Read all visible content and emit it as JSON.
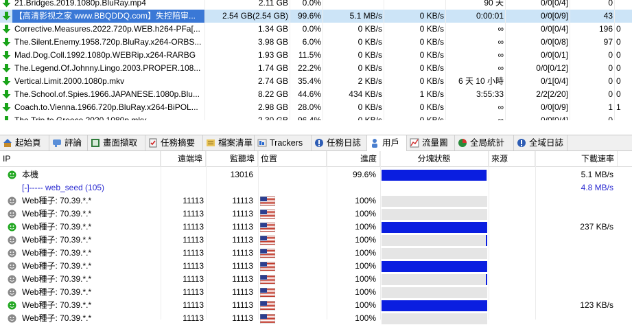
{
  "torrents": [
    {
      "name": "21.Bridges.2019.1080p.BluRay.mp4",
      "size": "2.11 GB",
      "pct": "0.0%",
      "dl": "",
      "ul": "",
      "eta": "90 天",
      "peers": "0/0[0/4]",
      "seeds": "0",
      "extra": ""
    },
    {
      "name": "【高清影视之家 www.BBQDDQ.com】失控陪审...",
      "size": "2.54 GB(2.54 GB)",
      "pct": "99.6%",
      "dl": "5.1 MB/s",
      "ul": "0 KB/s",
      "eta": "0:00:01",
      "peers": "0/0[0/9]",
      "seeds": "43",
      "extra": "",
      "selected": true
    },
    {
      "name": "Corrective.Measures.2022.720p.WEB.h264-PFa[...",
      "size": "1.34 GB",
      "pct": "0.0%",
      "dl": "0 KB/s",
      "ul": "0 KB/s",
      "eta": "∞",
      "peers": "0/0[0/4]",
      "seeds": "196",
      "extra": "0"
    },
    {
      "name": "The.Silent.Enemy.1958.720p.BluRay.x264-ORBS...",
      "size": "3.98 GB",
      "pct": "6.0%",
      "dl": "0 KB/s",
      "ul": "0 KB/s",
      "eta": "∞",
      "peers": "0/0[0/8]",
      "seeds": "97",
      "extra": "0"
    },
    {
      "name": "Mad.Dog.Coll.1992.1080p.WEBRip.x264-RARBG",
      "size": "1.93 GB",
      "pct": "11.5%",
      "dl": "0 KB/s",
      "ul": "0 KB/s",
      "eta": "∞",
      "peers": "0/0[0/1]",
      "seeds": "0",
      "extra": "0"
    },
    {
      "name": "The.Legend.Of.Johnny.Lingo.2003.PROPER.108...",
      "size": "1.74 GB",
      "pct": "22.2%",
      "dl": "0 KB/s",
      "ul": "0 KB/s",
      "eta": "∞",
      "peers": "0/0[0/12]",
      "seeds": "0",
      "extra": "0"
    },
    {
      "name": "Vertical.Limit.2000.1080p.mkv",
      "size": "2.74 GB",
      "pct": "35.4%",
      "dl": "2 KB/s",
      "ul": "0 KB/s",
      "eta": "6 天 10 小時",
      "peers": "0/1[0/4]",
      "seeds": "0",
      "extra": "0"
    },
    {
      "name": "The.School.of.Spies.1966.JAPANESE.1080p.Blu...",
      "size": "8.22 GB",
      "pct": "44.6%",
      "dl": "434 KB/s",
      "ul": "1 KB/s",
      "eta": "3:55:33",
      "peers": "2/2[2/20]",
      "seeds": "0",
      "extra": "0"
    },
    {
      "name": "Coach.to.Vienna.1966.720p.BluRay.x264-BiPOL...",
      "size": "2.98 GB",
      "pct": "28.0%",
      "dl": "0 KB/s",
      "ul": "0 KB/s",
      "eta": "∞",
      "peers": "0/0[0/9]",
      "seeds": "1",
      "extra": "1"
    },
    {
      "name": "The.Trip.to.Greece.2020.1080p.mkv",
      "size": "2.30 GB",
      "pct": "96.4%",
      "dl": "0 KB/s",
      "ul": "0 KB/s",
      "eta": "∞",
      "peers": "0/0[0/4]",
      "seeds": "0",
      "extra": ""
    }
  ],
  "tabs": [
    {
      "label": "起始頁",
      "icon": "home-icon"
    },
    {
      "label": "評論",
      "icon": "comment-icon"
    },
    {
      "label": "畫面擷取",
      "icon": "screenshot-icon"
    },
    {
      "label": "任務摘要",
      "icon": "summary-icon"
    },
    {
      "label": "檔案清單",
      "icon": "file-list-icon"
    },
    {
      "label": "Trackers",
      "icon": "trackers-icon"
    },
    {
      "label": "任務日誌",
      "icon": "task-log-icon"
    },
    {
      "label": "用戶",
      "icon": "users-icon",
      "active": true
    },
    {
      "label": "流量圖",
      "icon": "traffic-graph-icon"
    },
    {
      "label": "全局統計",
      "icon": "global-stats-icon"
    },
    {
      "label": "全域日誌",
      "icon": "global-log-icon"
    }
  ],
  "peer_headers": {
    "ip": "IP",
    "remote_port": "遠端埠",
    "listen_port": "監聽埠",
    "location": "位置",
    "progress": "進度",
    "pieces": "分塊狀態",
    "source": "來源",
    "dl_speed": "下載速率"
  },
  "peers": [
    {
      "ip": "本機",
      "port": "",
      "listen": "13016",
      "flag": false,
      "progress": "99.6%",
      "fill": 0.996,
      "dl": "5.1 MB/s",
      "status": "green",
      "blue": false
    },
    {
      "ip": "[-]----- web_seed (105)",
      "port": "",
      "listen": "",
      "flag": false,
      "progress": "",
      "fill": -1,
      "dl": "4.8 MB/s",
      "status": "none",
      "blue": true
    },
    {
      "ip": "Web種子: 70.39.*.*",
      "port": "11113",
      "listen": "11113",
      "flag": true,
      "progress": "100%",
      "fill": 0,
      "dl": "",
      "status": "gray",
      "blue": false
    },
    {
      "ip": "Web種子: 70.39.*.*",
      "port": "11113",
      "listen": "11113",
      "flag": true,
      "progress": "100%",
      "fill": 0,
      "dl": "",
      "status": "gray",
      "blue": false
    },
    {
      "ip": "Web種子: 70.39.*.*",
      "port": "11113",
      "listen": "11113",
      "flag": true,
      "progress": "100%",
      "fill": 1,
      "dl": "237 KB/s",
      "status": "green",
      "blue": false
    },
    {
      "ip": "Web種子: 70.39.*.*",
      "port": "11113",
      "listen": "11113",
      "flag": true,
      "progress": "100%",
      "fill": 0.01,
      "dl": "",
      "status": "gray",
      "blue": false
    },
    {
      "ip": "Web種子: 70.39.*.*",
      "port": "11113",
      "listen": "11113",
      "flag": true,
      "progress": "100%",
      "fill": 0,
      "dl": "",
      "status": "gray",
      "blue": false
    },
    {
      "ip": "Web種子: 70.39.*.*",
      "port": "11113",
      "listen": "11113",
      "flag": true,
      "progress": "100%",
      "fill": 1,
      "dl": "",
      "status": "gray",
      "blue": false
    },
    {
      "ip": "Web種子: 70.39.*.*",
      "port": "11113",
      "listen": "11113",
      "flag": true,
      "progress": "100%",
      "fill": 0.01,
      "dl": "",
      "status": "gray",
      "blue": false
    },
    {
      "ip": "Web種子: 70.39.*.*",
      "port": "11113",
      "listen": "11113",
      "flag": true,
      "progress": "100%",
      "fill": 0,
      "dl": "",
      "status": "gray",
      "blue": false
    },
    {
      "ip": "Web種子: 70.39.*.*",
      "port": "11113",
      "listen": "11113",
      "flag": true,
      "progress": "100%",
      "fill": 1,
      "dl": "123 KB/s",
      "status": "green",
      "blue": false
    },
    {
      "ip": "Web種子: 70.39.*.*",
      "port": "11113",
      "listen": "11113",
      "flag": true,
      "progress": "100%",
      "fill": 0,
      "dl": "",
      "status": "gray",
      "blue": false
    }
  ],
  "colors": {
    "selected_row": "#cce4f7",
    "piece_fill": "#0a1ee0",
    "status_green": "#22a822",
    "status_gray": "#888888",
    "download_arrow": "#1aa41a"
  }
}
